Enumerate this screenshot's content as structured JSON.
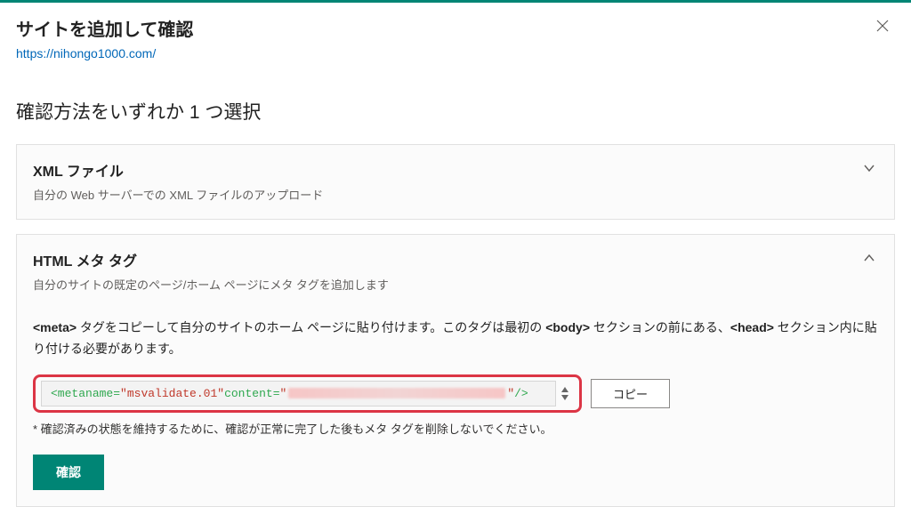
{
  "header": {
    "title": "サイトを追加して確認",
    "url": "https://nihongo1000.com/"
  },
  "section_title": "確認方法をいずれか 1 つ選択",
  "panels": {
    "xml": {
      "title": "XML ファイル",
      "subtitle": "自分の Web サーバーでの XML ファイルのアップロード"
    },
    "meta": {
      "title": "HTML メタ タグ",
      "subtitle": "自分のサイトの既定のページ/ホーム ページにメタ タグを追加します",
      "desc_prefix": "<meta>",
      "desc_mid1": " タグをコピーして自分のサイトのホーム ページに貼り付けます。このタグは最初の ",
      "desc_body": "<body>",
      "desc_mid2": " セクションの前にある、",
      "desc_head": "<head>",
      "desc_suffix": " セクション内に貼り付ける必要があります。",
      "code": {
        "tag_open": "<meta ",
        "name_attr": "name",
        "name_val": "\"msvalidate.01\"",
        "content_attr": " content",
        "content_val_open": "\"",
        "content_val_close": "\"",
        "tag_close": " />"
      },
      "copy_label": "コピー",
      "footnote": "* 確認済みの状態を維持するために、確認が正常に完了した後もメタ タグを削除しないでください。",
      "confirm_label": "確認"
    }
  }
}
